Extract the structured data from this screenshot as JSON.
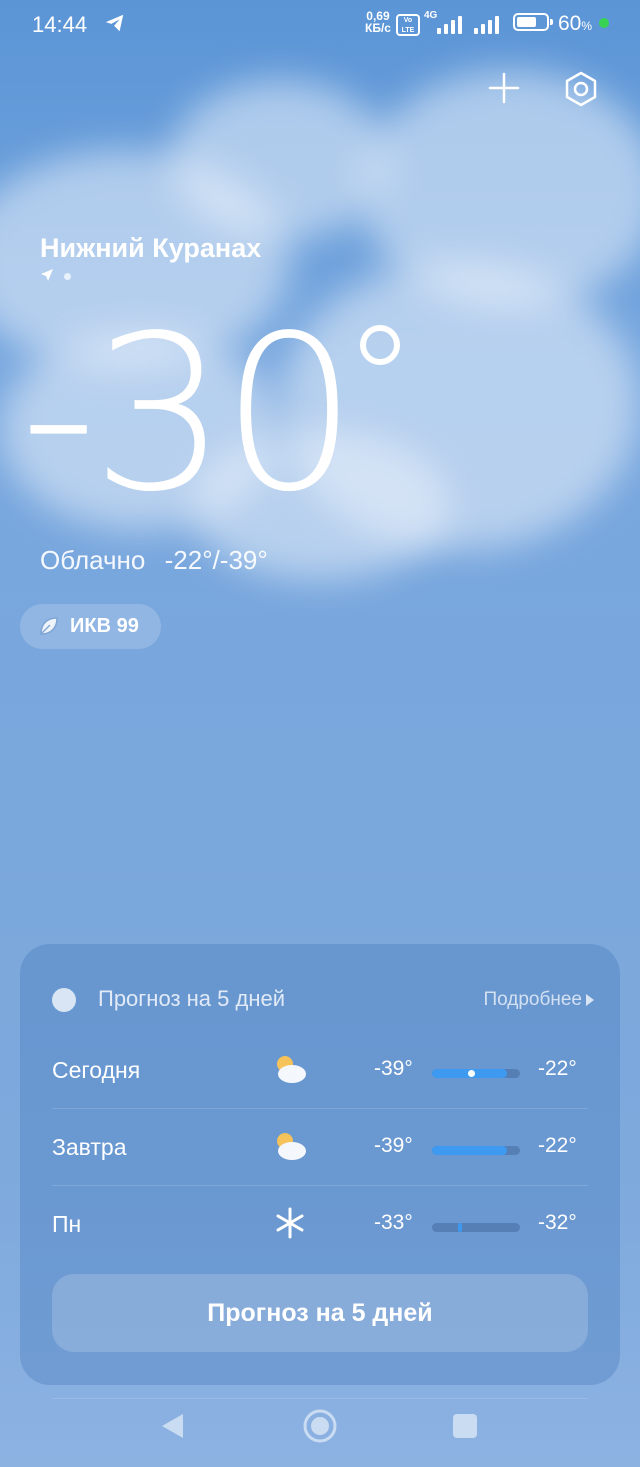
{
  "status_bar": {
    "time": "14:44",
    "net_speed_value": "0,69",
    "net_speed_unit": "КБ/с",
    "volte": "Vo LTE",
    "network": "4G",
    "battery_percent": "60",
    "battery_unit": "%",
    "battery_level": 0.6
  },
  "location": {
    "city": "Нижний Куранах"
  },
  "current": {
    "temperature": "-30",
    "condition": "Облачно",
    "range": "-22°/-39°",
    "aqi": "ИКВ 99"
  },
  "forecast": {
    "title": "Прогноз на 5 дней",
    "more": "Подробнее",
    "rows": [
      {
        "day": "Сегодня",
        "icon": "partly-cloudy-icon",
        "low": "-39°",
        "high": "-22°",
        "range_start": 0.0,
        "range_end": 0.85,
        "now": 0.45
      },
      {
        "day": "Завтра",
        "icon": "partly-cloudy-icon",
        "low": "-39°",
        "high": "-22°",
        "range_start": 0.0,
        "range_end": 0.85
      },
      {
        "day": "Пн",
        "icon": "snowflake-icon",
        "low": "-33°",
        "high": "-32°",
        "range_start": 0.29,
        "range_end": 0.34
      }
    ],
    "button": "Прогноз на 5 дней"
  },
  "colors": {
    "range_bar": "#3d9af0",
    "accent_green": "#39d353"
  }
}
